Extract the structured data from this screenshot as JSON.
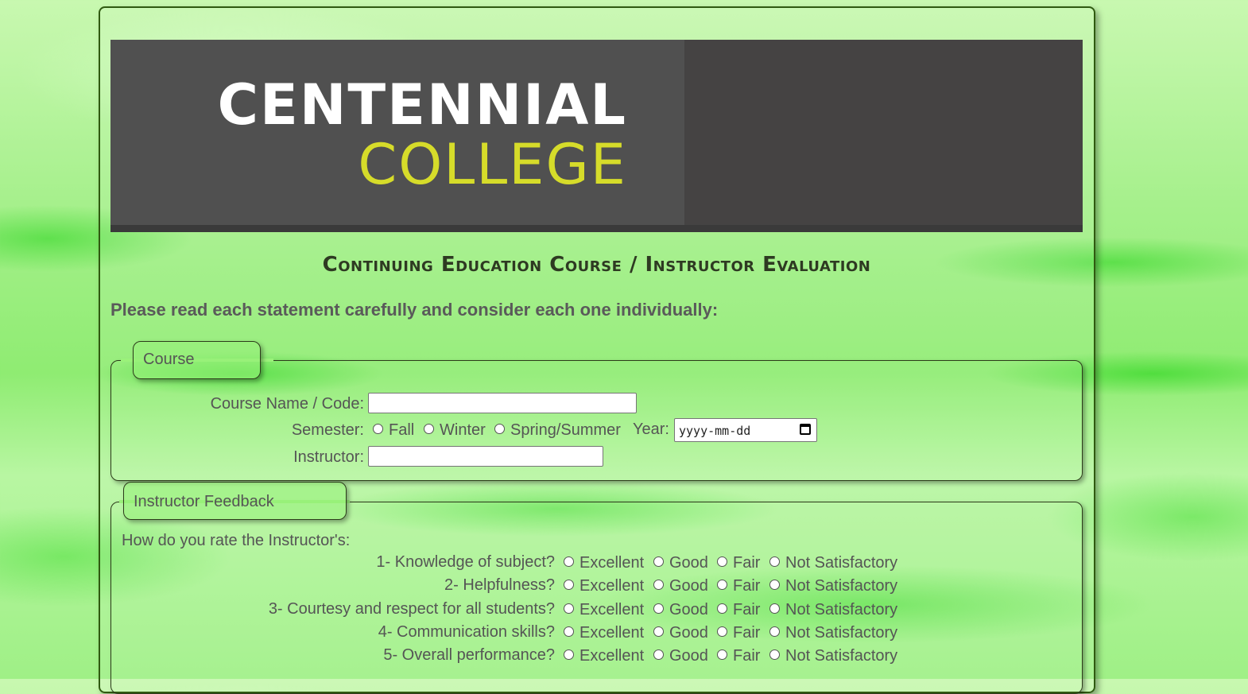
{
  "header": {
    "logo_line1": "CENTENNIAL",
    "logo_line2": "COLLEGE",
    "title": "Continuing Education Course / Instructor Evaluation",
    "instructions": "Please read each statement carefully and consider each one individually:"
  },
  "colors": {
    "background": "#9bf27a",
    "banner": "#454343",
    "logo_accent": "#d6dc2a"
  },
  "course": {
    "legend": "Course",
    "name_label": "Course Name / Code:",
    "name_value": "",
    "semester_label": "Semester:",
    "semester_options": [
      "Fall",
      "Winter",
      "Spring/Summer"
    ],
    "year_label": "Year:",
    "year_placeholder": "yyyy-mm-dd",
    "instructor_label": "Instructor:",
    "instructor_value": ""
  },
  "feedback": {
    "legend": "Instructor Feedback",
    "prompt": "How do you rate the Instructor's:",
    "rating_options": [
      "Excellent",
      "Good",
      "Fair",
      "Not Satisfactory"
    ],
    "questions": [
      "1- Knowledge of subject?",
      "2- Helpfulness?",
      "3- Courtesy and respect for all students?",
      "4- Communication skills?",
      "5- Overall performance?"
    ]
  }
}
